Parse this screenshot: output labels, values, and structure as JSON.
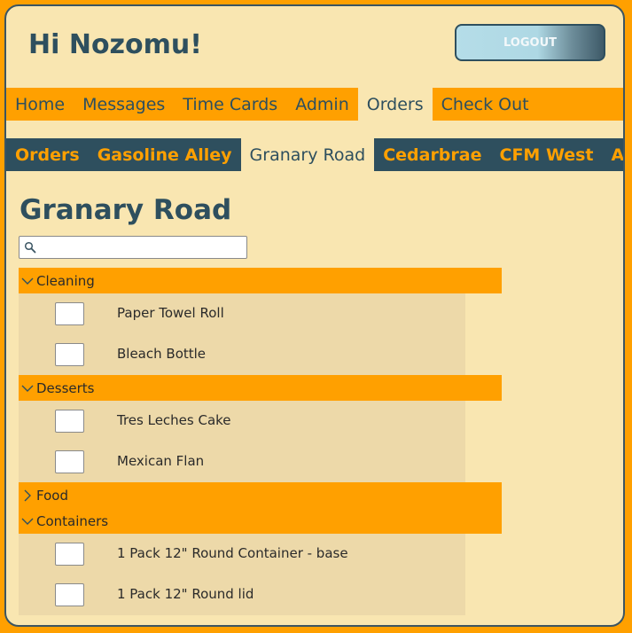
{
  "header": {
    "greeting": "Hi Nozomu!",
    "logout_label": "LOGOUT"
  },
  "main_nav": [
    {
      "label": "Home",
      "active": false
    },
    {
      "label": "Messages",
      "active": false
    },
    {
      "label": "Time Cards",
      "active": false
    },
    {
      "label": "Admin",
      "active": false
    },
    {
      "label": "Orders",
      "active": true
    },
    {
      "label": "Check Out",
      "active": false
    }
  ],
  "sub_nav": [
    {
      "label": "Orders",
      "active": false
    },
    {
      "label": "Gasoline Alley",
      "active": false
    },
    {
      "label": "Granary Road",
      "active": true
    },
    {
      "label": "Cedarbrae",
      "active": false
    },
    {
      "label": "CFM West",
      "active": false
    },
    {
      "label": "Avenida",
      "active": false
    }
  ],
  "page_title": "Granary Road",
  "search": {
    "value": "",
    "placeholder": "",
    "icon": "search-icon"
  },
  "categories": [
    {
      "label": "Cleaning",
      "expanded": true,
      "items": [
        {
          "name": "Paper Towel Roll",
          "quantity": ""
        },
        {
          "name": "Bleach Bottle",
          "quantity": ""
        }
      ]
    },
    {
      "label": "Desserts",
      "expanded": true,
      "items": [
        {
          "name": "Tres Leches Cake",
          "quantity": ""
        },
        {
          "name": "Mexican Flan",
          "quantity": ""
        }
      ]
    },
    {
      "label": "Food",
      "expanded": false,
      "items": []
    },
    {
      "label": "Containers",
      "expanded": true,
      "items": [
        {
          "name": "1 Pack 12\" Round Container - base",
          "quantity": ""
        },
        {
          "name": "1 Pack 12\" Round lid",
          "quantity": ""
        }
      ]
    }
  ],
  "colors": {
    "page_background": "#FFA000",
    "panel_background": "#F9E6B1",
    "navy": "#2E4F5E",
    "orange": "#FFA000",
    "item_area": "#EDD9A9"
  }
}
